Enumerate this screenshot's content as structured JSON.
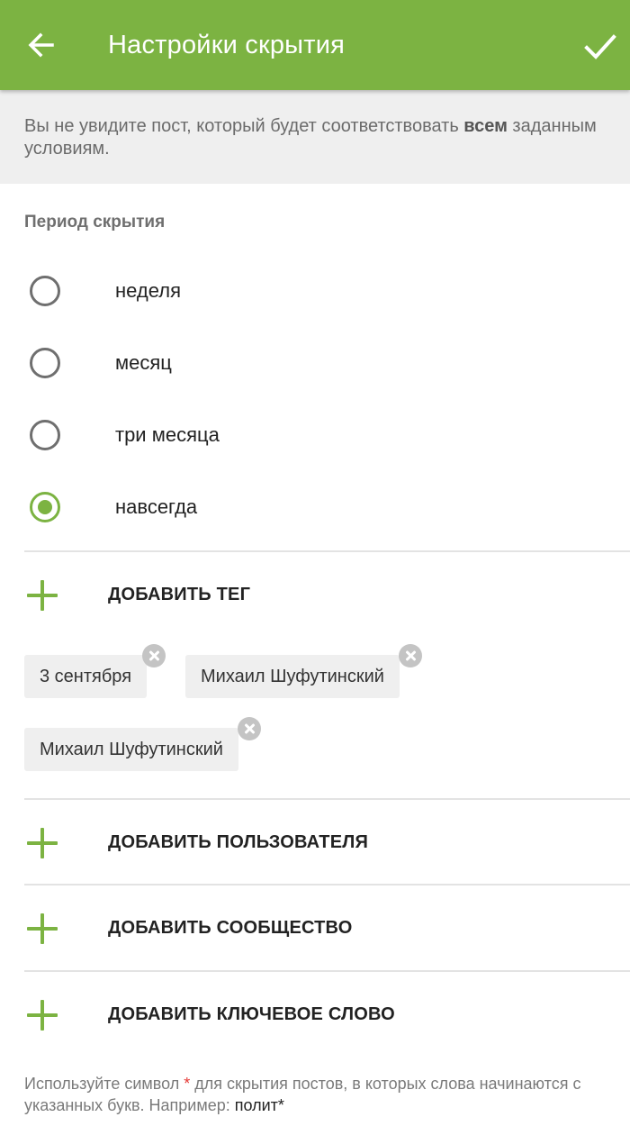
{
  "appbar": {
    "title": "Настройки скрытия",
    "back_icon": "arrow-left-icon",
    "done_icon": "check-icon",
    "color": "#7cb342"
  },
  "info": {
    "text_before": "Вы не увидите пост, который будет соответствовать ",
    "text_bold": "всем",
    "text_after": " заданным условиям."
  },
  "period": {
    "title": "Период скрытия",
    "options": [
      {
        "label": "неделя",
        "checked": false
      },
      {
        "label": "месяц",
        "checked": false
      },
      {
        "label": "три месяца",
        "checked": false
      },
      {
        "label": "навсегда",
        "checked": true
      }
    ]
  },
  "tags": {
    "add_label": "ДОБАВИТЬ ТЕГ",
    "chips": [
      "3 сентября",
      "Михаил Шуфутинский",
      "Михаил Шуфутинский"
    ]
  },
  "users": {
    "add_label": "ДОБАВИТЬ ПОЛЬЗОВАТЕЛЯ"
  },
  "communities": {
    "add_label": "ДОБАВИТЬ СООБЩЕСТВО"
  },
  "keywords": {
    "add_label": "ДОБАВИТЬ КЛЮЧЕВОЕ СЛОВО"
  },
  "footer": {
    "part1": "Используйте символ ",
    "star": "*",
    "part2": " для скрытия постов, в которых слова начинаются с указанных букв. Например: ",
    "example": "полит*"
  },
  "colors": {
    "accent": "#7cb342",
    "info_bg": "#efefef",
    "chip_bg": "#efefef",
    "star": "#e53935"
  }
}
